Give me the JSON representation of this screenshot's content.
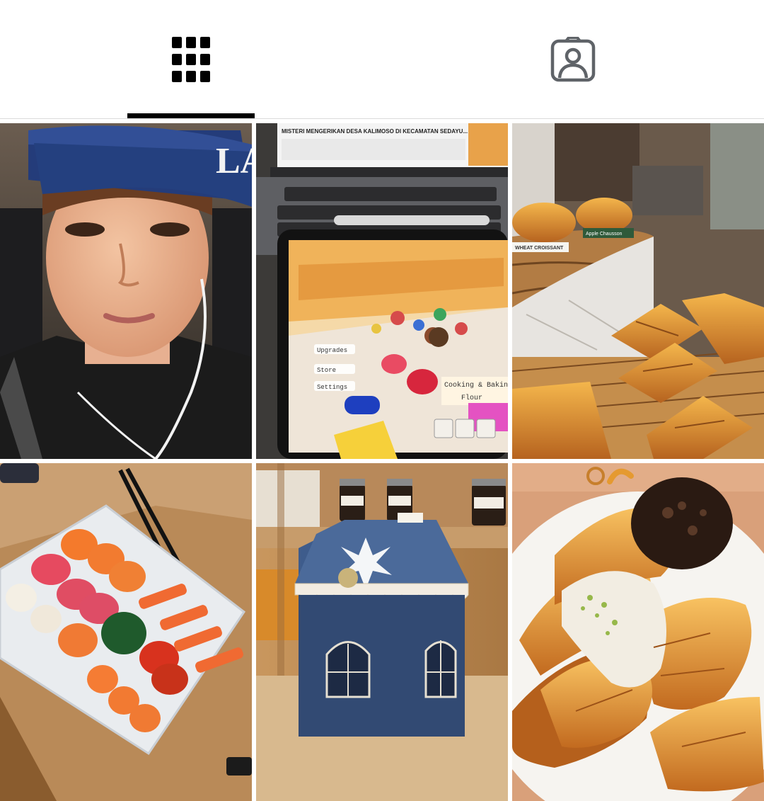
{
  "tabs": [
    {
      "name": "posts-grid",
      "icon": "grid-icon",
      "selected": true
    },
    {
      "name": "tagged",
      "icon": "tagged-person-icon",
      "selected": false
    }
  ],
  "posts": [
    {
      "subject": "selfie-cap",
      "cap_logo": "LA"
    },
    {
      "subject": "laptop-tablet-game",
      "screen_title": "MISTERI MENGERIKAN DESA KALIMOSO DI KECAMATAN SEDAYU... Remains",
      "menu": [
        "Upgrades",
        "Store",
        "Settings"
      ],
      "sign_line1": "Cooking & Baking",
      "sign_line2": "Flour"
    },
    {
      "subject": "bakery-pastries",
      "labels": [
        "WHEAT CROISSANT",
        "Apple Chausson"
      ]
    },
    {
      "subject": "sushi-platter"
    },
    {
      "subject": "house-shaped-box"
    },
    {
      "subject": "croissant-plate"
    }
  ]
}
